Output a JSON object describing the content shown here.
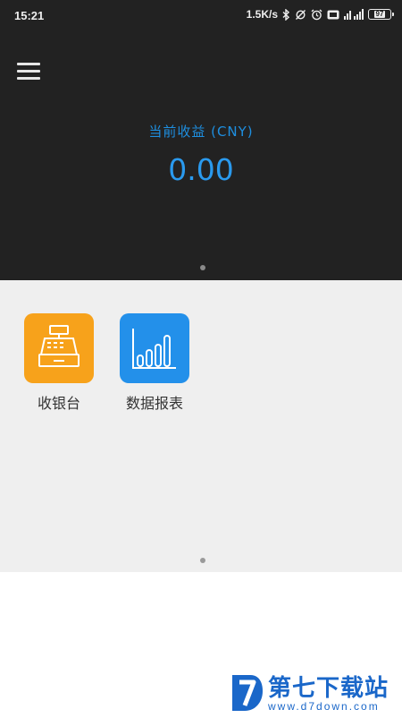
{
  "status_bar": {
    "time": "15:21",
    "network_speed": "1.5K/s",
    "battery": "97",
    "icons": [
      "bluetooth-icon",
      "sync-off-icon",
      "alarm-icon",
      "hd-icon",
      "signal-icon",
      "battery-icon"
    ]
  },
  "header": {
    "menu_icon": "hamburger-menu-icon",
    "earnings_label": "当前收益 (CNY)",
    "earnings_value": "0.00"
  },
  "apps": [
    {
      "label": "收银台",
      "icon": "cash-register-icon",
      "color": "#f7a21b"
    },
    {
      "label": "数据报表",
      "icon": "bar-chart-icon",
      "color": "#2390ea"
    }
  ],
  "pager": {
    "header_dot_color": "#8a8a8a",
    "grid_dot_color": "#9a9a9a"
  },
  "watermark": {
    "title": "第七下载站",
    "url": "www.d7down.com",
    "color": "#1a67c9"
  },
  "colors": {
    "header_bg": "#222222",
    "accent_blue": "#2a9aee",
    "grid_bg": "#efefef"
  }
}
